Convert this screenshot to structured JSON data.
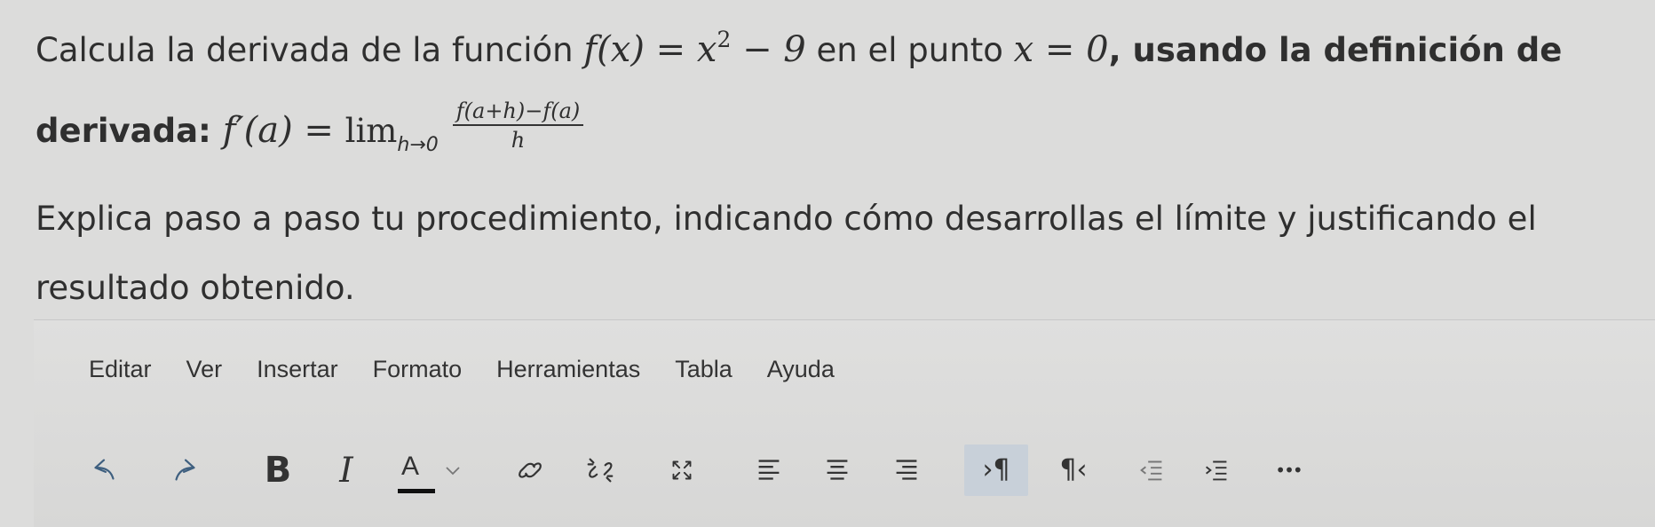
{
  "question": {
    "line1_start": "Calcula la derivada de la función ",
    "function_math": "f(x) = x",
    "function_exponent": "2",
    "function_tail": " − 9",
    "line1_mid": " en el punto ",
    "point_math": "x = 0",
    "line1_bold": ", usando la definición de",
    "line2_bold": "derivada: ",
    "derivative_math": "f′(a) = ",
    "lim_text": "lim",
    "lim_sub": "h→0",
    "fraction_numerator": "f(a+h)−f(a)",
    "fraction_denominator": "h",
    "line3": "Explica paso a paso tu procedimiento, indicando cómo desarrollas el límite y justificando el",
    "line4": "resultado obtenido."
  },
  "editor": {
    "menu": [
      "Editar",
      "Ver",
      "Insertar",
      "Formato",
      "Herramientas",
      "Tabla",
      "Ayuda"
    ],
    "toolbar": {
      "bold_label": "B",
      "italic_label": "I",
      "color_label": "A",
      "ltr_label": "›¶",
      "rtl_label": "¶‹",
      "more_label": "•••"
    },
    "icons": [
      "undo-icon",
      "redo-icon",
      "bold-icon",
      "italic-icon",
      "text-color-icon",
      "chevron-down-icon",
      "link-icon",
      "unlink-icon",
      "fullscreen-icon",
      "align-left-icon",
      "align-center-icon",
      "align-right-icon",
      "ltr-icon",
      "rtl-icon",
      "outdent-icon",
      "indent-icon",
      "more-icon"
    ],
    "active_color": "#c8d0d9"
  }
}
